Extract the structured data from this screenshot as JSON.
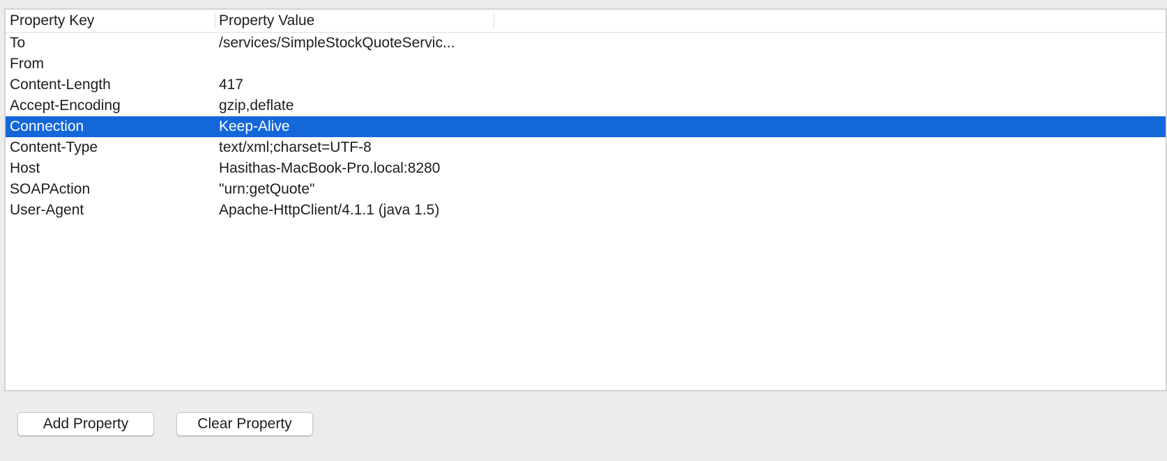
{
  "table": {
    "columns": [
      "Property Key",
      "Property Value"
    ],
    "rows": [
      {
        "key": "To",
        "value": "/services/SimpleStockQuoteServic...",
        "selected": false
      },
      {
        "key": "From",
        "value": "",
        "selected": false
      },
      {
        "key": "Content-Length",
        "value": "417",
        "selected": false
      },
      {
        "key": "Accept-Encoding",
        "value": "gzip,deflate",
        "selected": false
      },
      {
        "key": "Connection",
        "value": "Keep-Alive",
        "selected": true
      },
      {
        "key": "Content-Type",
        "value": "text/xml;charset=UTF-8",
        "selected": false
      },
      {
        "key": "Host",
        "value": "Hasithas-MacBook-Pro.local:8280",
        "selected": false
      },
      {
        "key": "SOAPAction",
        "value": "\"urn:getQuote\"",
        "selected": false
      },
      {
        "key": "User-Agent",
        "value": "Apache-HttpClient/4.1.1 (java 1.5)",
        "selected": false
      }
    ],
    "selection_color": "#1467d9"
  },
  "buttons": {
    "add_label": "Add Property",
    "clear_label": "Clear Property"
  }
}
